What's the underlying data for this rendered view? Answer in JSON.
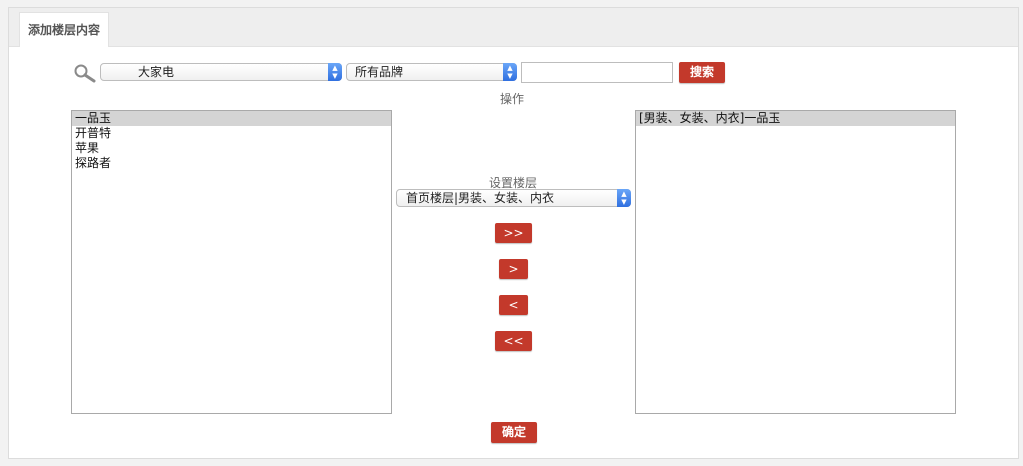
{
  "header": {
    "tab_title": "添加楼层内容"
  },
  "search": {
    "category_select": "大家电",
    "brand_select": "所有品牌",
    "keyword_value": "",
    "search_button": "搜索"
  },
  "operation_label": "操作",
  "left_list": {
    "items": [
      {
        "label": "一品玉",
        "selected": true
      },
      {
        "label": "开普特",
        "selected": false
      },
      {
        "label": "苹果",
        "selected": false
      },
      {
        "label": "探路者",
        "selected": false
      }
    ]
  },
  "middle": {
    "floor_label": "设置楼层",
    "floor_select": "首页楼层|男装、女装、内衣",
    "move_all_right": ">>",
    "move_right": ">",
    "move_left": "<",
    "move_all_left": "<<"
  },
  "right_list": {
    "items": [
      {
        "label": "[男装、女装、内衣]一品玉",
        "selected": true
      }
    ]
  },
  "confirm_button": "确定"
}
